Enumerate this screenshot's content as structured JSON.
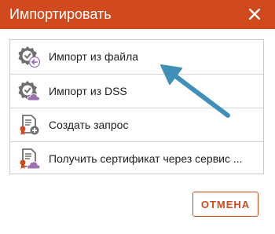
{
  "dialog": {
    "title": "Импортировать",
    "close_icon": "close-icon",
    "cancel_label": "ОТМЕНА"
  },
  "items": [
    {
      "label": "Импорт из файла",
      "icon": "certificate-import-icon"
    },
    {
      "label": "Импорт из DSS",
      "icon": "certificate-cloud-icon"
    },
    {
      "label": "Создать запрос",
      "icon": "document-add-icon"
    },
    {
      "label": "Получить сертификат через сервис ...",
      "icon": "document-cloud-icon"
    }
  ],
  "colors": {
    "accent": "#d04a1d",
    "arrow": "#3f8fb8",
    "icon_gray": "#6f6f6f",
    "icon_purple": "#9d6fb3"
  }
}
